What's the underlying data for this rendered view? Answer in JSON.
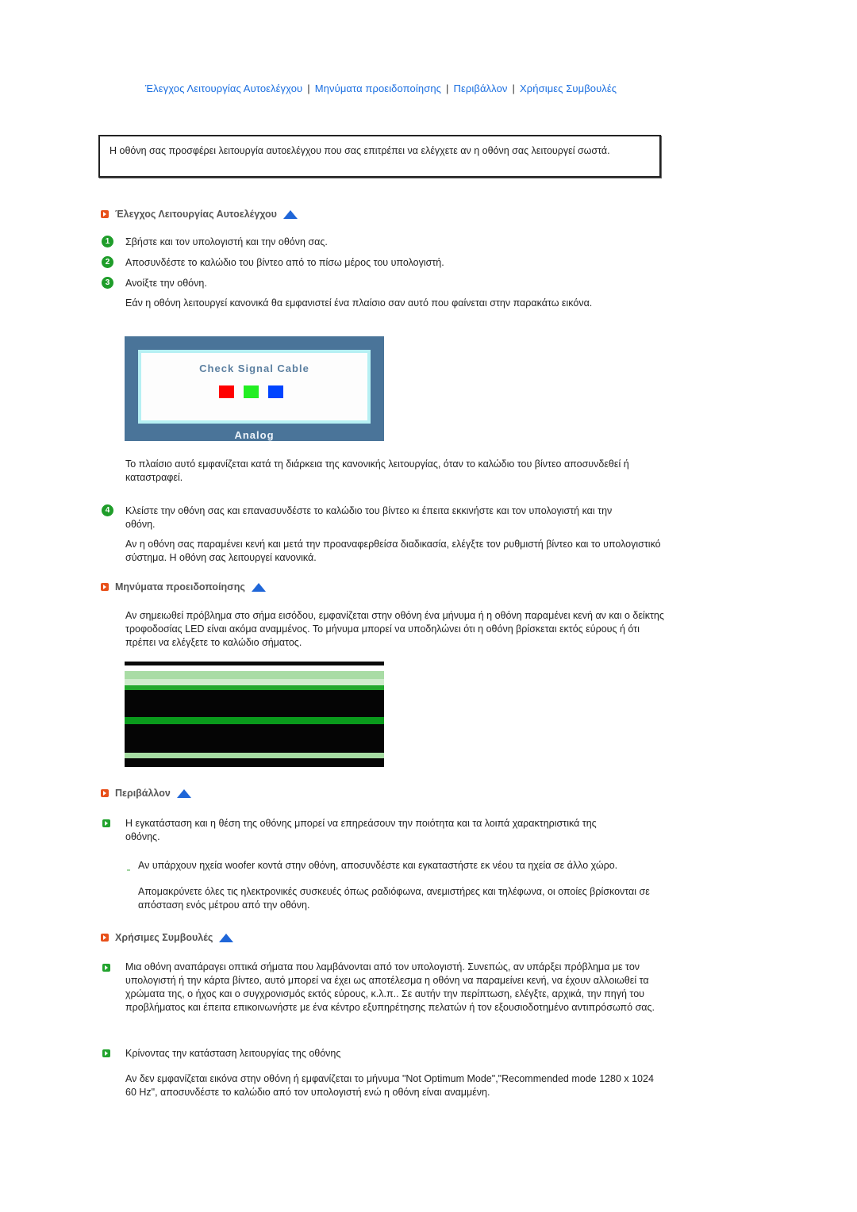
{
  "nav": {
    "links": [
      "Έλεγχος Λειτουργίας Αυτοελέγχου",
      "Μηνύματα προειδοποίησης",
      "Περιβάλλον",
      "Χρήσιμες Συμβουλές"
    ],
    "separator": "|"
  },
  "intro": "Η οθόνη σας προσφέρει λειτουργία αυτοελέγχου που σας επιτρέπει να ελέγχετε αν η οθόνη σας λειτουργεί σωστά.",
  "self_test": {
    "heading": "Έλεγχος Λειτουργίας Αυτοελέγχου",
    "steps": [
      {
        "num": "1",
        "text": "Σβήστε και τον υπολογιστή και την οθόνη σας."
      },
      {
        "num": "2",
        "text": "Αποσυνδέστε το καλώδιο του βίντεο από το πίσω μέρος του υπολογιστή."
      },
      {
        "num": "3",
        "text": "Ανοίξτε την οθόνη."
      }
    ],
    "step3_note": "Εάν η οθόνη λειτουργεί κανονικά θα εμφανιστεί ένα πλαίσιο σαν αυτό που φαίνεται στην παρακάτω εικόνα.",
    "osd": {
      "title": "Check Signal Cable",
      "label": "Analog",
      "squares": [
        "#ff0000",
        "#22ee22",
        "#0044ff"
      ]
    },
    "osd_note": "Το πλαίσιο αυτό εμφανίζεται κατά τη διάρκεια της κανονικής λειτουργίας, όταν το καλώδιο του βίντεο αποσυνδεθεί ή καταστραφεί.",
    "step4": {
      "num": "4",
      "text": "Κλείστε την οθόνη σας και επανασυνδέστε το καλώδιο του βίντεο κι έπειτα εκκινήστε και τον υπολογιστή και την οθόνη."
    },
    "step4_note": "Αν η οθόνη σας παραμένει κενή και μετά την προαναφερθείσα διαδικασία, ελέγξτε τον ρυθμιστή βίντεο και το υπολογιστικό σύστημα. Η οθόνη σας λειτουργεί κανονικά."
  },
  "warnings": {
    "heading": "Μηνύματα προειδοποίησης",
    "text": "Αν σημειωθεί πρόβλημα στο σήμα εισόδου, εμφανίζεται στην οθόνη ένα μήνυμα ή η οθόνη παραμένει κενή αν και ο δείκτης τροφοδοσίας LED είναι ακόμα αναμμένος. Το μήνυμα μπορεί να υποδηλώνει ότι η οθόνη βρίσκεται εκτός εύρους ή ότι πρέπει να ελέγξετε το καλώδιο σήματος."
  },
  "environment": {
    "heading": "Περιβάλλον",
    "text": "Η εγκατάσταση και η θέση της οθόνης μπορεί να επηρεάσουν την ποιότητα και τα λοιπά χαρακτηριστικά της οθόνης.",
    "sub1": "Αν υπάρχουν ηχεία woofer κοντά στην οθόνη, αποσυνδέστε και εγκαταστήστε εκ νέου τα ηχεία σε άλλο χώρο.",
    "sub2": "Απομακρύνετε όλες τις ηλεκτρονικές συσκευές όπως ραδιόφωνα, ανεμιστήρες και τηλέφωνα, οι οποίες βρίσκονται σε απόσταση ενός μέτρου από την οθόνη."
  },
  "tips": {
    "heading": "Χρήσιμες Συμβουλές",
    "text": "Μια οθόνη αναπάραγει οπτικά σήματα που λαμβάνονται από τον υπολογιστή. Συνεπώς, αν υπάρξει πρόβλημα με τον υπολογιστή ή την κάρτα βίντεο, αυτό μπορεί να έχει ως αποτέλεσμα η οθόνη να παραμείνει κενή, να έχουν αλλοιωθεί τα χρώματα της, ο ήχος και ο συγχρονισμός εκτός εύρους, κ.λ.π.. Σε αυτήν την περίπτωση, ελέγξτε, αρχικά, την πηγή του προβλήματος και έπειτα επικοινωνήστε με ένα κέντρο εξυπηρέτησης πελατών ή τον εξουσιοδοτημένο αντιπρόσωπό σας.",
    "item2": "Κρίνοντας την κατάσταση λειτουργίας της οθόνης",
    "item2_note": "Αν δεν εμφανίζεται εικόνα στην οθόνη ή εμφανίζεται το μήνυμα \"Not Optimum Mode\",\"Recommended mode 1280 x 1024 60 Hz\", αποσυνδέστε το καλώδιο από τον υπολογιστή ενώ η οθόνη είναι αναμμένη."
  },
  "colors": {
    "link": "#1a6ee0",
    "heading_bullet": "#e8501a",
    "step_icon": "#1f9d2a",
    "up_arrow": "#1f66d8",
    "osd_frame": "#4a7499"
  }
}
